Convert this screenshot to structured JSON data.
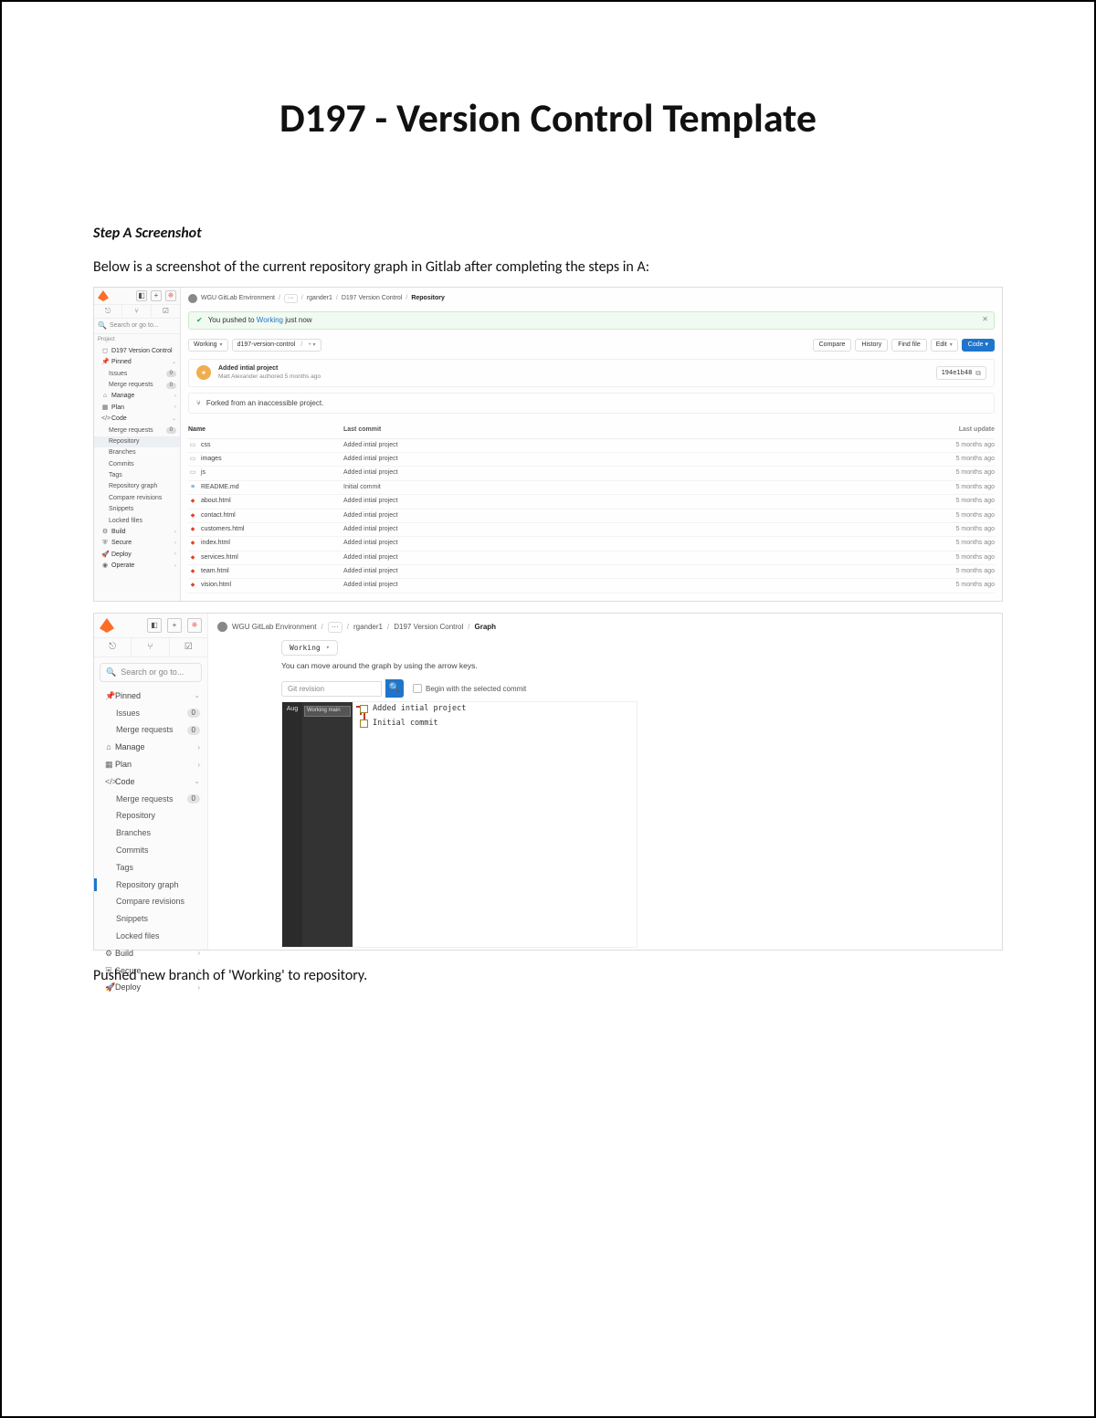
{
  "doc": {
    "title": "D197 - Version Control Template",
    "step_title": "Step A Screenshot",
    "intro": "Below is a screenshot of the current repository graph in Gitlab after completing the steps in A:",
    "caption2": "Pushed new branch of 'Working' to repository."
  },
  "shot1": {
    "sidebar": {
      "search_placeholder": "Search or go to...",
      "section": "Project",
      "project_name": "D197 Version Control",
      "pinned": "Pinned",
      "issues": "Issues",
      "merge_requests": "Merge requests",
      "manage": "Manage",
      "plan": "Plan",
      "code": "Code",
      "mr2": "Merge requests",
      "repository": "Repository",
      "branches": "Branches",
      "commits": "Commits",
      "tags": "Tags",
      "repo_graph": "Repository graph",
      "compare": "Compare revisions",
      "snippets": "Snippets",
      "locked": "Locked files",
      "build": "Build",
      "secure": "Secure",
      "deploy": "Deploy",
      "operate": "Operate",
      "badge0": "0"
    },
    "crumb": {
      "env": "WGU GitLab Environment",
      "user": "rgander1",
      "proj": "D197 Version Control",
      "last": "Repository"
    },
    "notif": {
      "prefix": "You pushed to ",
      "branch": "Working",
      "suffix": " just now"
    },
    "toolbar": {
      "branch": "Working",
      "repo": "d197-version-control",
      "compare": "Compare",
      "history": "History",
      "findfile": "Find file",
      "edit": "Edit",
      "code": "Code"
    },
    "commit": {
      "title": "Added intial project",
      "author": "Matt Alexander",
      "when": " authored 5 months ago",
      "hash": "194e1b48"
    },
    "forked": "Forked from an inaccessible project.",
    "table": {
      "h_name": "Name",
      "h_last": "Last commit",
      "h_upd": "Last update",
      "rows": [
        {
          "icon": "folder",
          "name": "css",
          "last": "Added intial project",
          "upd": "5 months ago"
        },
        {
          "icon": "folder",
          "name": "images",
          "last": "Added intial project",
          "upd": "5 months ago"
        },
        {
          "icon": "folder",
          "name": "js",
          "last": "Added intial project",
          "upd": "5 months ago"
        },
        {
          "icon": "md",
          "name": "README.md",
          "last": "Initial commit",
          "upd": "5 months ago"
        },
        {
          "icon": "html",
          "name": "about.html",
          "last": "Added intial project",
          "upd": "5 months ago"
        },
        {
          "icon": "html",
          "name": "contact.html",
          "last": "Added intial project",
          "upd": "5 months ago"
        },
        {
          "icon": "html",
          "name": "customers.html",
          "last": "Added intial project",
          "upd": "5 months ago"
        },
        {
          "icon": "html",
          "name": "index.html",
          "last": "Added intial project",
          "upd": "5 months ago"
        },
        {
          "icon": "html",
          "name": "services.html",
          "last": "Added intial project",
          "upd": "5 months ago"
        },
        {
          "icon": "html",
          "name": "team.html",
          "last": "Added intial project",
          "upd": "5 months ago"
        },
        {
          "icon": "html",
          "name": "vision.html",
          "last": "Added intial project",
          "upd": "5 months ago"
        }
      ]
    }
  },
  "shot2": {
    "sidebar": {
      "search_placeholder": "Search or go to...",
      "pinned": "Pinned",
      "issues": "Issues",
      "merge_requests": "Merge requests",
      "manage": "Manage",
      "plan": "Plan",
      "code": "Code",
      "mr2": "Merge requests",
      "repository": "Repository",
      "branches": "Branches",
      "commits": "Commits",
      "tags": "Tags",
      "repo_graph": "Repository graph",
      "compare": "Compare revisions",
      "snippets": "Snippets",
      "locked": "Locked files",
      "build": "Build",
      "secure": "Secure",
      "deploy": "Deploy",
      "badge0": "0"
    },
    "crumb": {
      "env": "WGU GitLab Environment",
      "user": "rgander1",
      "proj": "D197 Version Control",
      "last": "Graph"
    },
    "branch": "Working",
    "hint": "You can move around the graph by using the arrow keys.",
    "rev_placeholder": "Git revision",
    "chk_label": "Begin with the selected commit",
    "month": "Aug",
    "branchtag": "Working main",
    "node1": "Added intial project",
    "node2": "Initial commit"
  }
}
